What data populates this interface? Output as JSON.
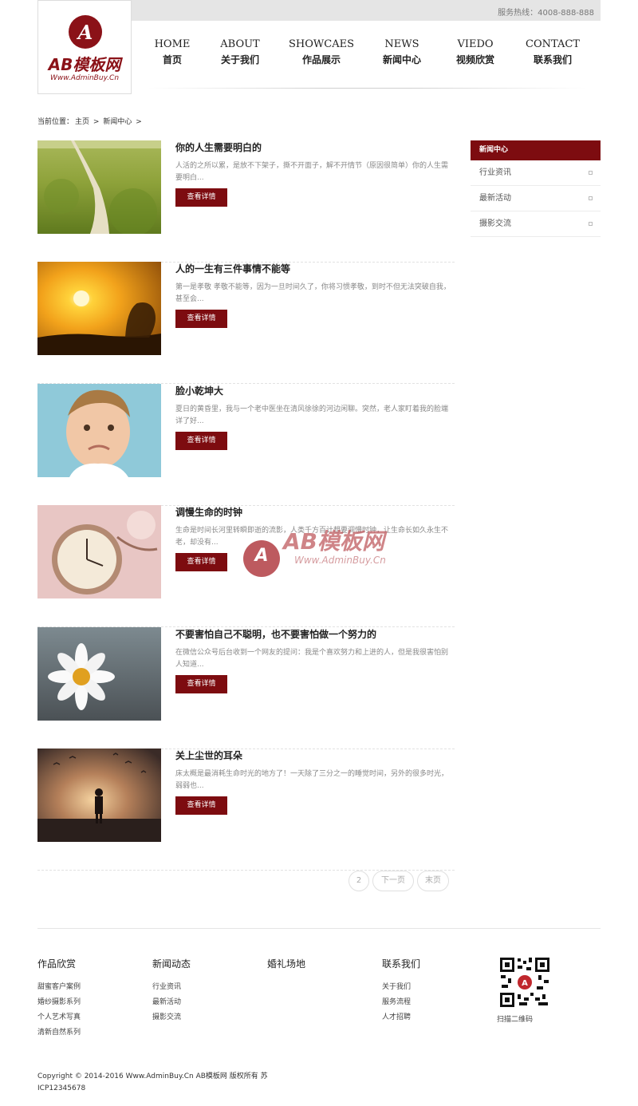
{
  "header": {
    "hotline": "服务热线：4008-888-888",
    "logo": {
      "badge_letter": "A",
      "brand": "AB模板网",
      "site": "Www.AdminBuy.Cn"
    },
    "nav": [
      {
        "en": "HOME",
        "cn": "首页"
      },
      {
        "en": "ABOUT",
        "cn": "关于我们"
      },
      {
        "en": "SHOWCAES",
        "cn": "作品展示"
      },
      {
        "en": "NEWS",
        "cn": "新闻中心"
      },
      {
        "en": "VIEDO",
        "cn": "视频欣赏"
      },
      {
        "en": "CONTACT",
        "cn": "联系我们"
      }
    ]
  },
  "breadcrumb": {
    "label": "当前位置：",
    "home": "主页",
    "sep": ">",
    "current": "新闻中心",
    "tail": ">"
  },
  "articles": [
    {
      "title": "你的人生需要明白的",
      "summary": "人活的之所以累，是放不下架子，撕不开面子，解不开情节（原因很简单）你的人生需要明白...",
      "more": "查看详情",
      "image": "field-path"
    },
    {
      "title": "人的一生有三件事情不能等",
      "summary": "第一是孝敬 孝敬不能等，因为一旦时间久了，你将习惯孝敬，到时不但无法突破自我，甚至会...",
      "more": "查看详情",
      "image": "sunset"
    },
    {
      "title": "脸小乾坤大",
      "summary": "夏日的黄昏里，我与一个老中医坐在清风徐徐的河边闲聊。突然，老人家盯着我的脸端详了好...",
      "more": "查看详情",
      "image": "baby"
    },
    {
      "title": "调慢生命的时钟",
      "summary": "生命是时间长河里转瞬即逝的流影，人类千方百计想要调慢时钟，让生命长如久永生不老，却没有...",
      "more": "查看详情",
      "image": "pocket-watch"
    },
    {
      "title": "不要害怕自己不聪明，也不要害怕做一个努力的",
      "summary": "在微信公众号后台收到一个网友的提问：我是个喜欢努力和上进的人，但是我很害怕别人知道...",
      "more": "查看详情",
      "image": "daisy"
    },
    {
      "title": "关上尘世的耳朵",
      "summary": "床太概是最消耗生命时光的地方了！一天除了三分之一的睡觉时间，另外的很多时光，弱弱也...",
      "more": "查看详情",
      "image": "silhouette"
    }
  ],
  "pager": {
    "page": "2",
    "next": "下一页",
    "last": "末页"
  },
  "sidebar": {
    "title": "新闻中心",
    "items": [
      "行业资讯",
      "最新活动",
      "摄影交流"
    ]
  },
  "footer": {
    "columns": [
      {
        "title": "作品欣赏",
        "links": [
          "甜蜜客户案例",
          "婚纱摄影系列",
          "个人艺术写真",
          "清新自然系列"
        ]
      },
      {
        "title": "新闻动态",
        "links": [
          "行业资讯",
          "最新活动",
          "摄影交流"
        ]
      },
      {
        "title": "婚礼场地",
        "links": []
      },
      {
        "title": "联系我们",
        "links": [
          "关于我们",
          "服务流程",
          "人才招聘"
        ]
      }
    ],
    "qr_caption": "扫描二维码",
    "copyright_line1": "Copyright © 2014-2016 Www.AdminBuy.Cn AB模板网 版权所有 苏",
    "copyright_line2": "ICP12345678"
  },
  "watermark": {
    "brand": "AB模板网",
    "site": "Www.AdminBuy.Cn",
    "letter": "A"
  },
  "colors": {
    "accent": "#7d0c10",
    "topbar": "#e5e5e5"
  }
}
